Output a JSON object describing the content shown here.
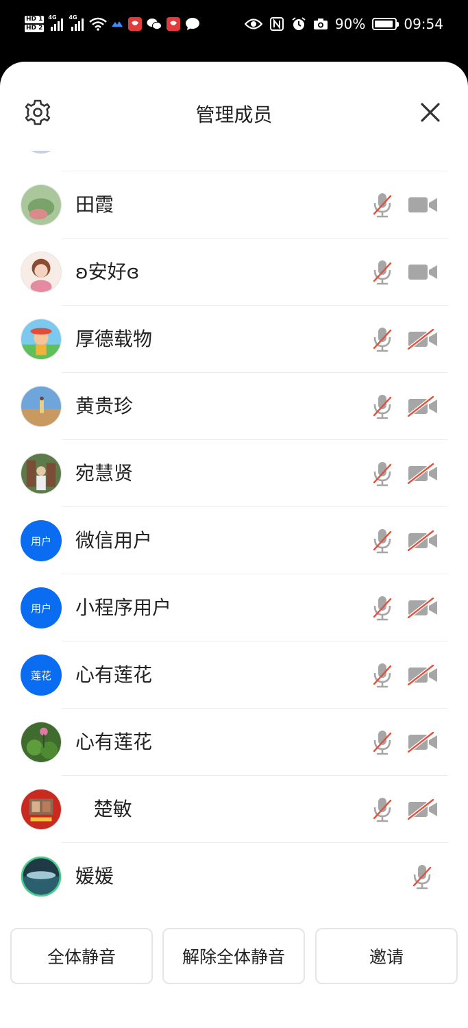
{
  "status_bar": {
    "hd1": "HD 1",
    "hd2": "HD 2",
    "sim1_type": "4G",
    "sim2_type": "4G",
    "battery_percent": "90%",
    "battery_level": 0.9,
    "time": "09:54"
  },
  "header": {
    "title": "管理成员",
    "settings_icon": "gear-icon",
    "close_icon": "close-icon"
  },
  "members": [
    {
      "name": "田霞",
      "avatar": "photo",
      "mic": "muted",
      "camera": "on"
    },
    {
      "name": "ʚ安好ɞ",
      "avatar": "photo",
      "mic": "muted",
      "camera": "on"
    },
    {
      "name": "厚德载物",
      "avatar": "photo",
      "mic": "muted",
      "camera": "off"
    },
    {
      "name": "黄贵珍",
      "avatar": "photo",
      "mic": "muted",
      "camera": "off"
    },
    {
      "name": "宛慧贤",
      "avatar": "photo",
      "mic": "muted",
      "camera": "off"
    },
    {
      "name": "微信用户",
      "avatar_text": "用户",
      "mic": "muted",
      "camera": "off"
    },
    {
      "name": "小程序用户",
      "avatar_text": "用户",
      "mic": "muted",
      "camera": "off"
    },
    {
      "name": "心有莲花",
      "avatar_text": "莲花",
      "mic": "muted",
      "camera": "off"
    },
    {
      "name": "心有莲花",
      "avatar": "photo",
      "mic": "muted",
      "camera": "off"
    },
    {
      "name": "   楚敏",
      "avatar": "photo",
      "mic": "muted",
      "camera": "off"
    },
    {
      "name": "媛媛",
      "avatar": "photo",
      "mic": "muted",
      "camera": "none"
    }
  ],
  "actions": {
    "mute_all": "全体静音",
    "unmute_all": "解除全体静音",
    "invite": "邀请"
  },
  "colors": {
    "accent_blue": "#0a6cf0",
    "icon_gray": "#a6a6a6",
    "mute_red": "#e0533f",
    "divider": "#ececec"
  }
}
